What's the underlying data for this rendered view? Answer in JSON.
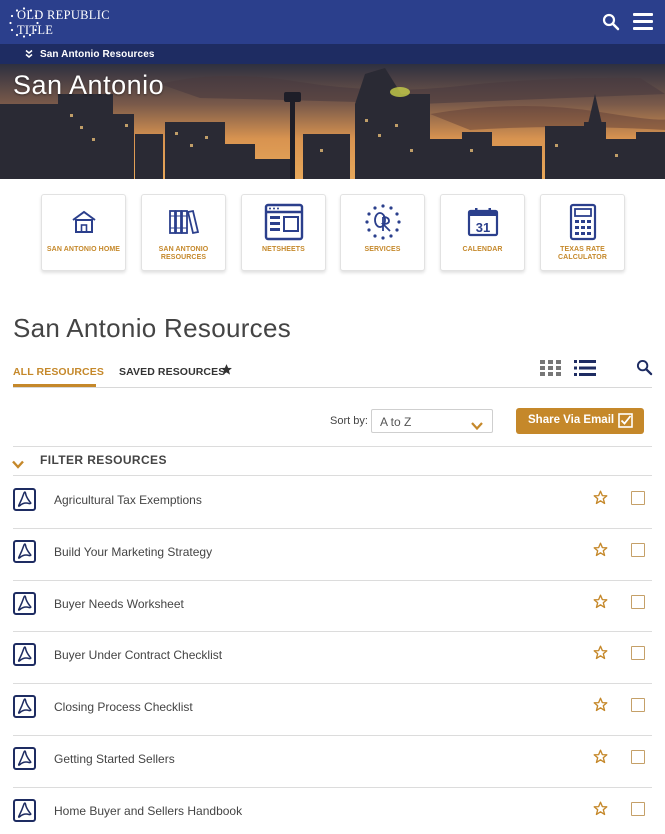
{
  "header": {
    "logo_text": "OLD REPUBLIC TITLE",
    "brand_color": "#2b3f8c",
    "subbar_color": "#1e2c62",
    "accent_color": "#c5882a"
  },
  "subnav": {
    "label": "San Antonio Resources"
  },
  "hero": {
    "title": "San Antonio"
  },
  "tiles": [
    {
      "label": "SAN ANTONIO HOME",
      "icon": "home-icon"
    },
    {
      "label": "SAN ANTONIO RESOURCES",
      "icon": "books-icon"
    },
    {
      "label": "NETSHEETS",
      "icon": "netsheet-icon"
    },
    {
      "label": "SERVICES",
      "icon": "or-seal-icon"
    },
    {
      "label": "CALENDAR",
      "icon": "calendar-icon",
      "date": "31"
    },
    {
      "label": "TEXAS RATE CALCULATOR",
      "icon": "calculator-icon"
    }
  ],
  "page": {
    "title": "San Antonio Resources"
  },
  "tabs": {
    "all": "ALL RESOURCES",
    "saved": "SAVED RESOURCES"
  },
  "sort": {
    "label": "Sort by:",
    "value": "A to Z"
  },
  "share": {
    "label": "Share Via Email"
  },
  "filter": {
    "label": "FILTER RESOURCES"
  },
  "resources": [
    "Agricultural Tax Exemptions",
    "Build Your Marketing Strategy",
    "Buyer Needs Worksheet",
    "Buyer Under Contract Checklist",
    "Closing Process Checklist",
    "Getting Started Sellers",
    "Home Buyer and Sellers Handbook"
  ]
}
